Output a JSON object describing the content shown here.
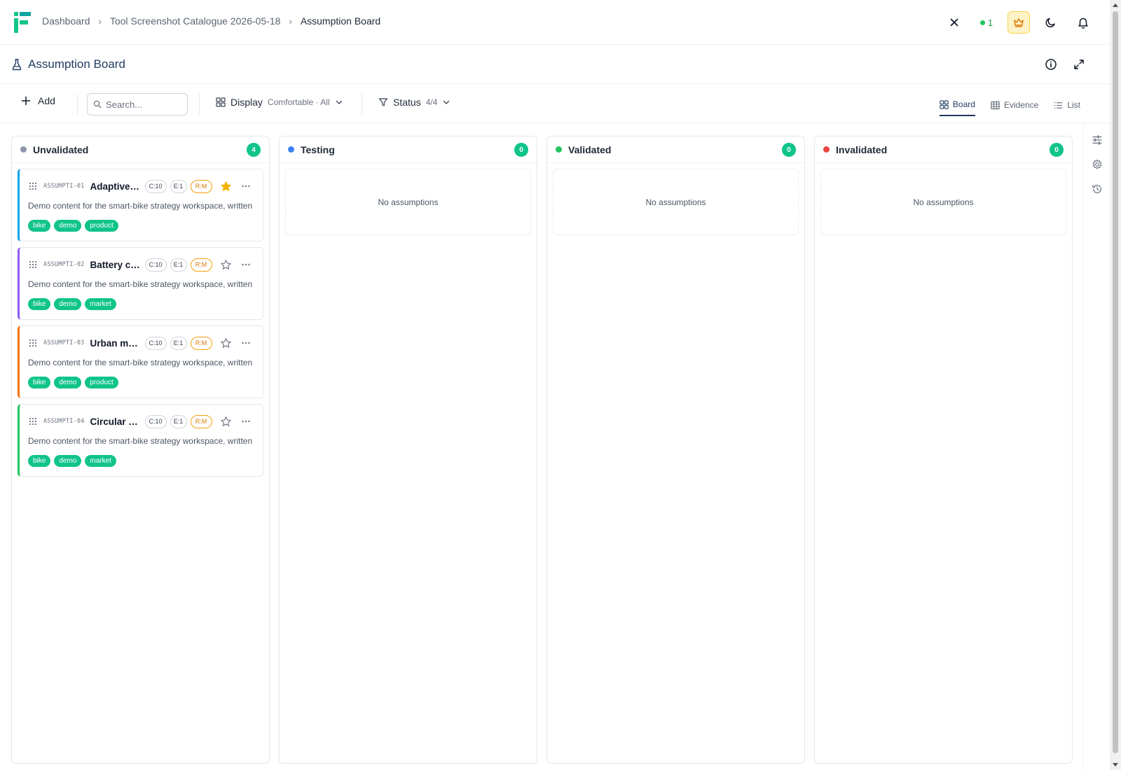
{
  "breadcrumb": {
    "items": [
      "Dashboard",
      "Tool Screenshot Catalogue 2026-05-18",
      "Assumption Board"
    ]
  },
  "topbar": {
    "presence_count": "1",
    "icons": [
      "close-icon",
      "crown-icon",
      "moon-icon",
      "bell-icon"
    ]
  },
  "page": {
    "title": "Assumption Board"
  },
  "toolbar": {
    "add_label": "Add",
    "search_placeholder": "Search...",
    "display_label": "Display",
    "display_value": "Comfortable · All",
    "status_label": "Status",
    "status_value": "4/4",
    "views": [
      {
        "label": "Board",
        "icon": "board-icon",
        "active": true
      },
      {
        "label": "Evidence",
        "icon": "table-icon",
        "active": false
      },
      {
        "label": "List",
        "icon": "list-icon",
        "active": false
      }
    ]
  },
  "columns": [
    {
      "title": "Unvalidated",
      "count": "4",
      "dot_color": "#8b95a7",
      "empty_label": "",
      "cards": [
        {
          "id": "ASSUMPTI-01",
          "title": "Adaptive assist tuning",
          "c": "C:10",
          "e": "E:1",
          "r": "R:M",
          "starred": true,
          "accent": "#0ea5e9",
          "description": "Demo content for the smart-bike strategy workspace, written to make the tool state visible in catalogue screenshots.",
          "tags": [
            "bike",
            "demo",
            "product"
          ]
        },
        {
          "id": "ASSUMPTI-02",
          "title": "Battery capacity",
          "c": "C:10",
          "e": "E:1",
          "r": "R:M",
          "starred": false,
          "accent": "#8b5cf6",
          "description": "Demo content for the smart-bike strategy workspace, written to make the tool state visible in catalogue screenshots.",
          "tags": [
            "bike",
            "demo",
            "market"
          ]
        },
        {
          "id": "ASSUMPTI-03",
          "title": "Urban mobility",
          "c": "C:10",
          "e": "E:1",
          "r": "R:M",
          "starred": false,
          "accent": "#f97316",
          "description": "Demo content for the smart-bike strategy workspace, written to make the tool state visible in catalogue screenshots.",
          "tags": [
            "bike",
            "demo",
            "product"
          ]
        },
        {
          "id": "ASSUMPTI-04",
          "title": "Circular frame",
          "c": "C:10",
          "e": "E:1",
          "r": "R:M",
          "starred": false,
          "accent": "#22c55e",
          "description": "Demo content for the smart-bike strategy workspace, written to make the tool state visible in catalogue screenshots.",
          "tags": [
            "bike",
            "demo",
            "market"
          ]
        }
      ]
    },
    {
      "title": "Testing",
      "count": "0",
      "dot_color": "#3b82f6",
      "empty_label": "No assumptions",
      "cards": []
    },
    {
      "title": "Validated",
      "count": "0",
      "dot_color": "#22c55e",
      "empty_label": "No assumptions",
      "cards": []
    },
    {
      "title": "Invalidated",
      "count": "0",
      "dot_color": "#ef4444",
      "empty_label": "No assumptions",
      "cards": []
    }
  ],
  "rail": {
    "icons": [
      "sliders-icon",
      "gear-icon",
      "history-icon"
    ]
  },
  "colors": {
    "accent": "#10c48a",
    "brand": "#1e3a5f",
    "star": "#f5b301"
  }
}
